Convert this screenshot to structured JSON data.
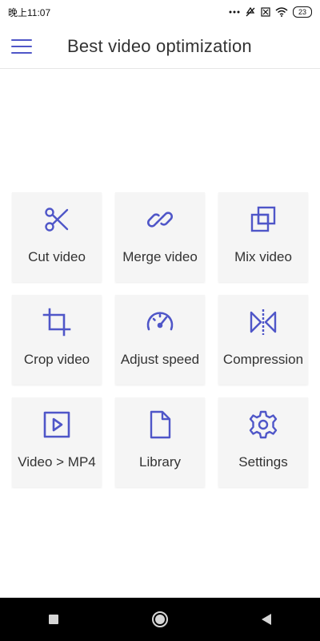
{
  "status_bar": {
    "time": "晚上11:07",
    "battery": "23"
  },
  "app_bar": {
    "title": "Best video optimization",
    "menu_icon": "hamburger-menu-icon"
  },
  "tiles": [
    {
      "label": "Cut video",
      "icon": "scissors-icon"
    },
    {
      "label": "Merge video",
      "icon": "link-icon"
    },
    {
      "label": "Mix video",
      "icon": "layers-icon"
    },
    {
      "label": "Crop video",
      "icon": "crop-icon"
    },
    {
      "label": "Adjust speed",
      "icon": "speedometer-icon"
    },
    {
      "label": "Compression",
      "icon": "compress-icon"
    },
    {
      "label": "Video > MP4",
      "icon": "play-box-icon"
    },
    {
      "label": "Library",
      "icon": "file-icon"
    },
    {
      "label": "Settings",
      "icon": "gear-icon"
    }
  ],
  "nav_bar": {
    "buttons": [
      "recent-apps-icon",
      "home-icon",
      "back-icon"
    ]
  },
  "colors": {
    "accent": "#4f56c8",
    "tile_bg": "#f5f5f5",
    "nav_bg": "#000000"
  }
}
